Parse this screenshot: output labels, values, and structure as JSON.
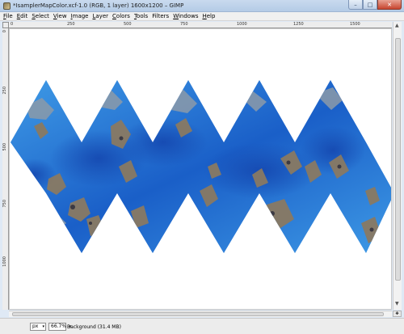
{
  "window": {
    "title": "*IsamplerMapColor.xcf-1.0 (RGB, 1 layer) 1600x1200 – GIMP",
    "minimize_label": "–",
    "maximize_label": "□",
    "close_label": "✕"
  },
  "menu": {
    "items": [
      {
        "accel": "F",
        "rest": "ile"
      },
      {
        "accel": "E",
        "rest": "dit"
      },
      {
        "accel": "S",
        "rest": "elect"
      },
      {
        "accel": "V",
        "rest": "iew"
      },
      {
        "accel": "I",
        "rest": "mage"
      },
      {
        "accel": "L",
        "rest": "ayer"
      },
      {
        "accel": "C",
        "rest": "olors"
      },
      {
        "accel": "T",
        "rest": "ools"
      },
      {
        "accel": "",
        "rest": "Filters"
      },
      {
        "accel": "W",
        "rest": "indows"
      },
      {
        "accel": "H",
        "rest": "elp"
      }
    ]
  },
  "rulers": {
    "horizontal_ticks": [
      "0",
      "250",
      "500",
      "750",
      "1000",
      "1250",
      "1500"
    ],
    "vertical_ticks": [
      "0",
      "250",
      "500",
      "750",
      "1000"
    ]
  },
  "canvas": {
    "background_color": "#ffffff",
    "map_colors": {
      "ocean_deep": "#1a5fc8",
      "ocean_light": "#3f9be6",
      "land": "#8a7a62",
      "ice": "#8c9aa8"
    }
  },
  "statusbar": {
    "unit": "px",
    "zoom": "66.7%",
    "message": "Background (31.4 MB)"
  }
}
